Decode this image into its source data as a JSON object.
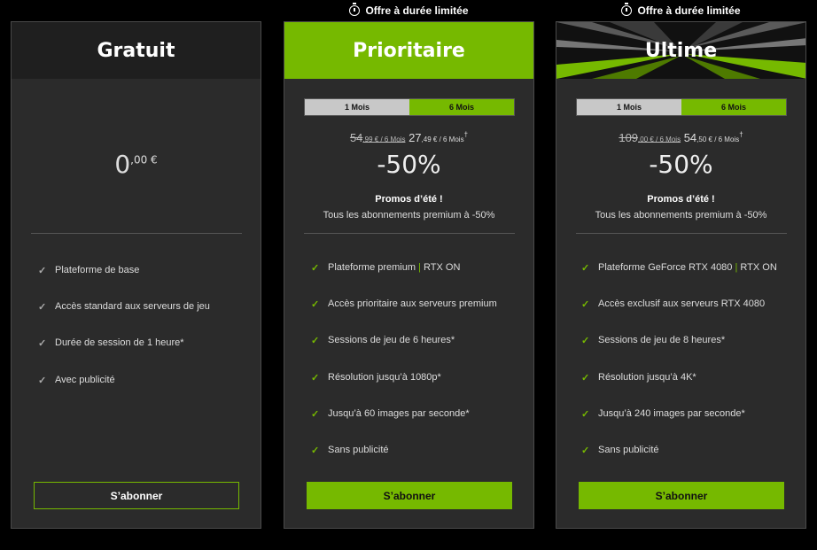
{
  "banner": "Offre à durée limitée",
  "toggle": {
    "one": "1 Mois",
    "six": "6 Mois"
  },
  "promo": {
    "title": "Promos d’été !",
    "subtitle": "Tous les abonnements premium à -50%"
  },
  "subscribe": "S’abonner",
  "plans": {
    "free": {
      "name": "Gratuit",
      "price_int": "0",
      "price_dec": ",00 €",
      "features": [
        "Plateforme de base",
        "Accès standard aux serveurs de jeu",
        "Durée de session de 1 heure*",
        "Avec publicité"
      ]
    },
    "priority": {
      "name": "Prioritaire",
      "old_int": "54",
      "old_dec": ",99 € / 6 Mois",
      "new_int": "27",
      "new_dec": ",49 € / 6 Mois",
      "new_mark": "†",
      "discount": "-50%",
      "features": [
        "Plateforme premium",
        "RTX ON",
        "Accès prioritaire aux serveurs premium",
        "Sessions de jeu de 6 heures*",
        "Résolution jusqu’à 1080p*",
        "Jusqu’à 60 images par seconde*",
        "Sans publicité"
      ]
    },
    "ultimate": {
      "name": "Ultime",
      "old_int": "109",
      "old_dec": ",00 € / 6 Mois",
      "new_int": "54",
      "new_dec": ",50 € / 6 Mois",
      "new_mark": "†",
      "discount": "-50%",
      "features": [
        "Plateforme GeForce RTX 4080",
        "RTX ON",
        "Accès exclusif aux serveurs RTX 4080",
        "Sessions de jeu de 8 heures*",
        "Résolution jusqu’à 4K*",
        "Jusqu’à 240 images par seconde*",
        "Sans publicité"
      ]
    }
  },
  "colors": {
    "accent": "#76b900",
    "card": "#2b2b2b",
    "background": "#000000"
  }
}
